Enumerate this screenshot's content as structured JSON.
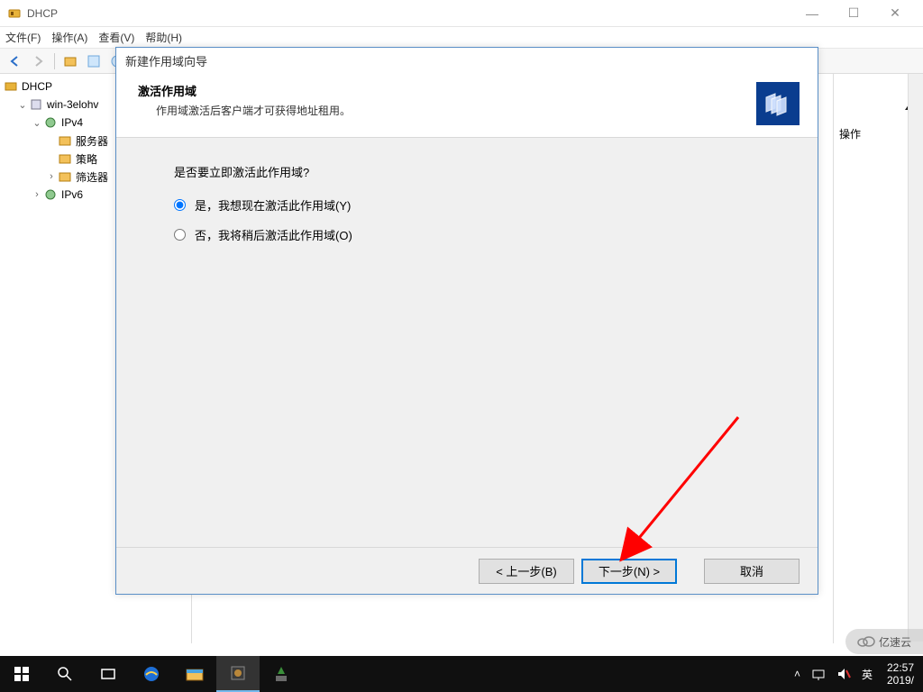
{
  "window": {
    "title": "DHCP",
    "menu": {
      "file": "文件(F)",
      "action": "操作(A)",
      "view": "查看(V)",
      "help": "帮助(H)"
    }
  },
  "tree": {
    "root": "DHCP",
    "server": "win-3elohv",
    "ipv4": "IPv4",
    "server_options": "服务器",
    "policies": "策略",
    "filters": "筛选器",
    "ipv6": "IPv6"
  },
  "actions": {
    "header": "操作"
  },
  "wizard": {
    "title": "新建作用域向导",
    "heading": "激活作用域",
    "subheading": "作用域激活后客户端才可获得地址租用。",
    "question": "是否要立即激活此作用域?",
    "opt_yes": "是，我想现在激活此作用域(Y)",
    "opt_no": "否，我将稍后激活此作用域(O)",
    "back": "< 上一步(B)",
    "next": "下一步(N) >",
    "cancel": "取消"
  },
  "taskbar": {
    "ime": "英",
    "time": "22:57",
    "date": "2019/"
  },
  "watermark": "亿速云"
}
